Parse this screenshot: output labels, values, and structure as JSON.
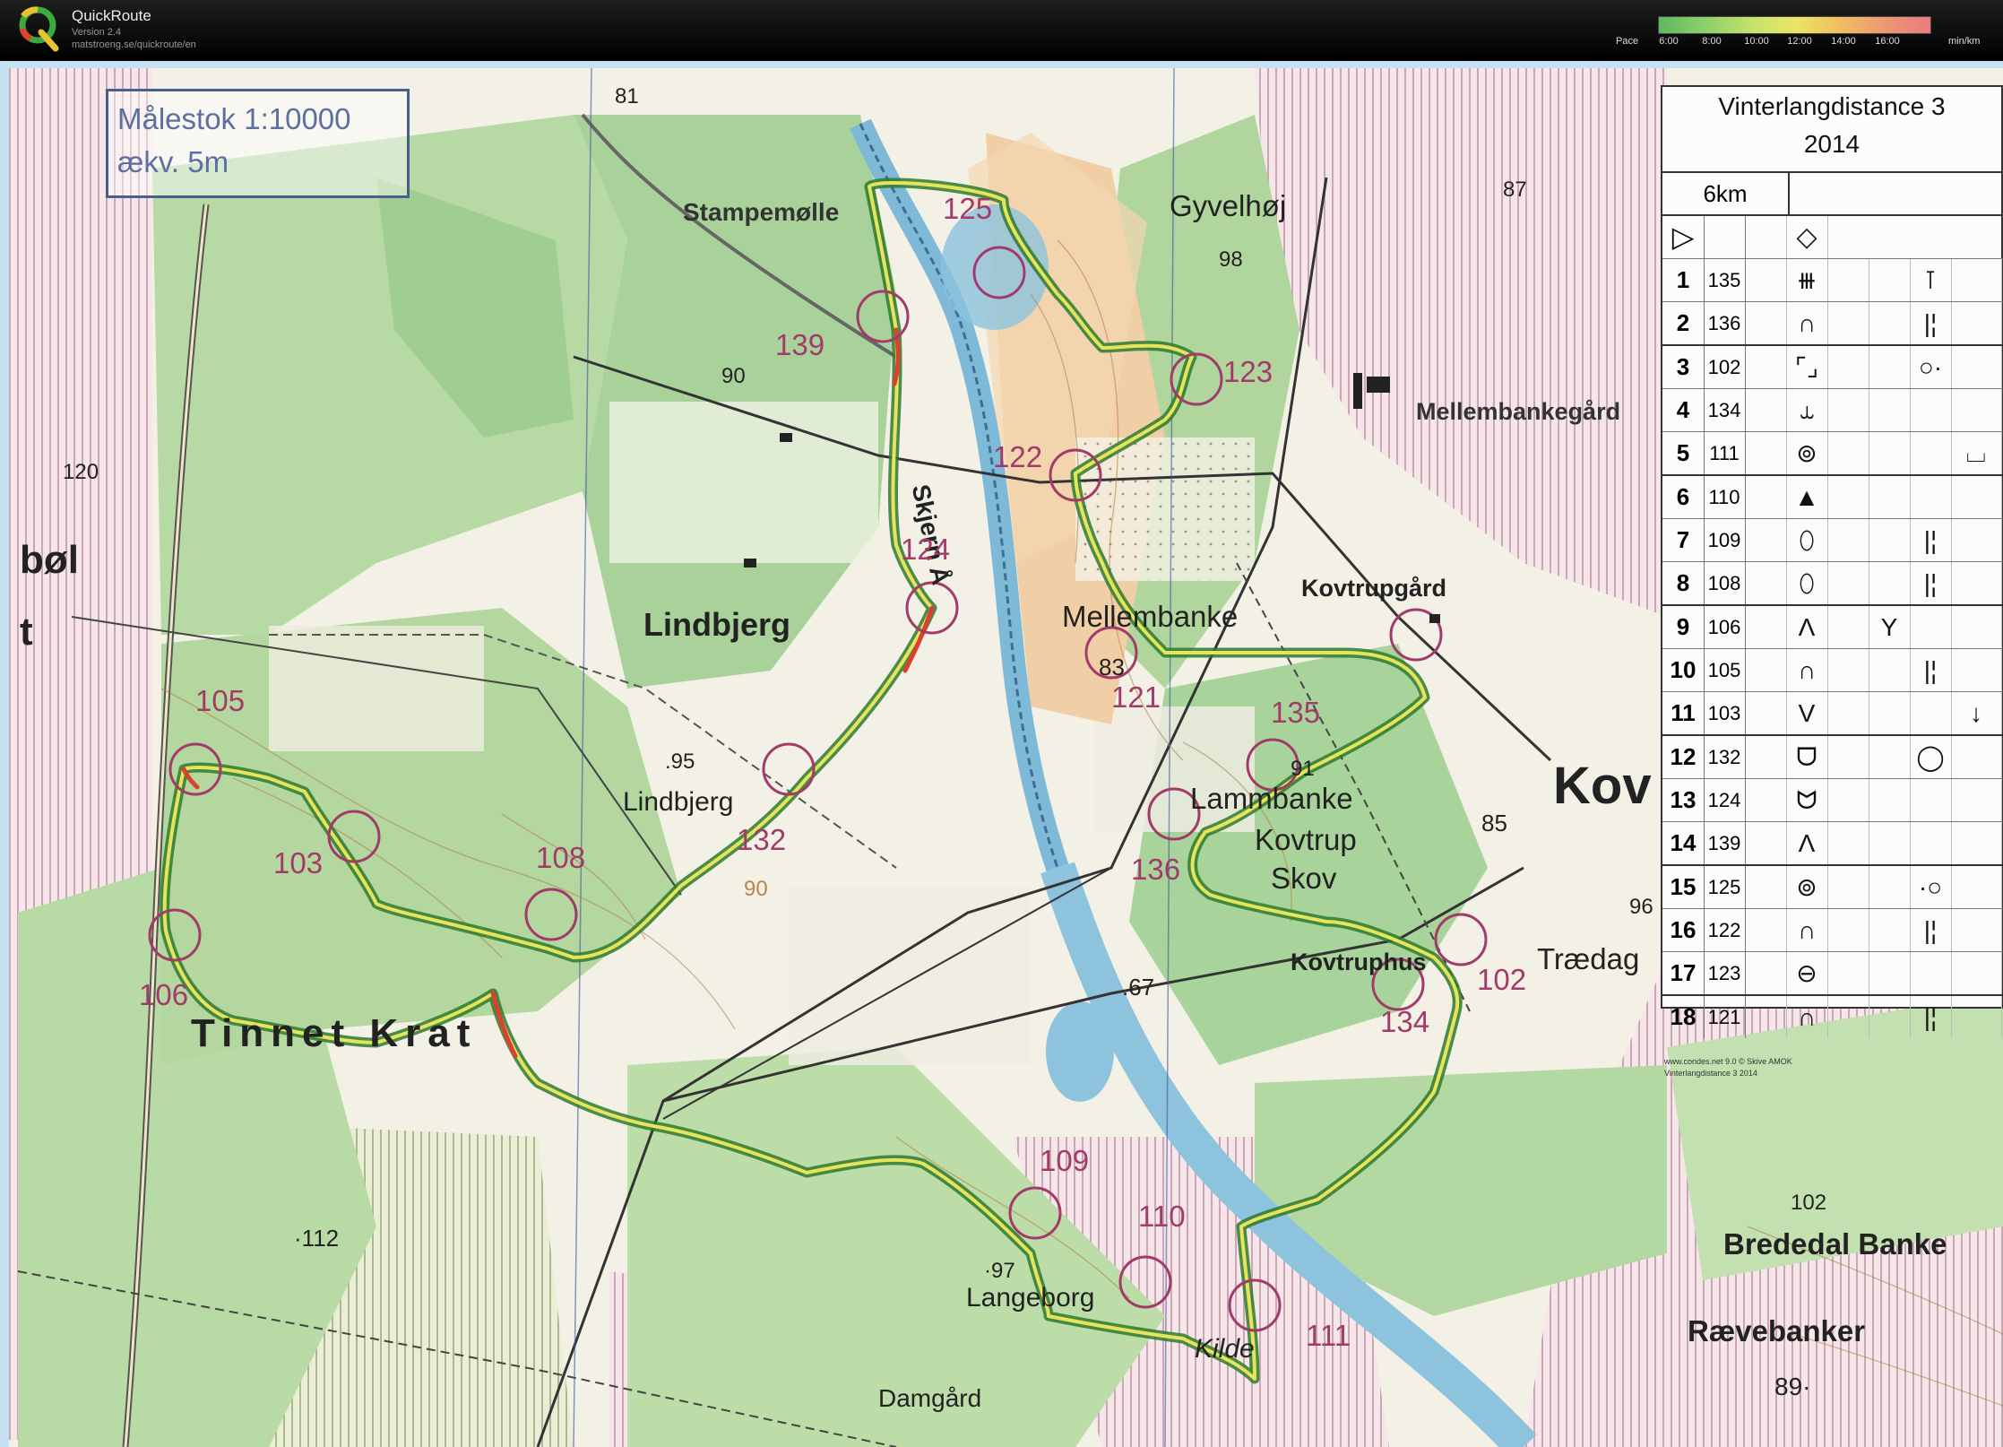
{
  "app": {
    "name": "QuickRoute",
    "version": "Version 2.4",
    "url": "matstroeng.se/quickroute/en"
  },
  "pace": {
    "label": "Pace",
    "ticks": [
      "6:00",
      "8:00",
      "10:00",
      "12:00",
      "14:00",
      "16:00"
    ],
    "unit": "min/km",
    "colors": [
      "#5eb85e",
      "#c9e46a",
      "#e9e565",
      "#f0c060",
      "#e87b80"
    ]
  },
  "map": {
    "scale_line1": "Målestok 1:10000",
    "scale_line2": "ækv. 5m",
    "place_names": {
      "stampemolle": "Stampemølle",
      "gyvelhoj": "Gyvelhøj",
      "mellembankegard": "Mellembankegård",
      "skjern_a": "Skjern Å",
      "lindbjerg_1": "Lindbjerg",
      "lindbjerg_2": "Lindbjerg",
      "mellembanke": "Mellembanke",
      "kovtrupgard": "Kovtrupgård",
      "kov": "Kov",
      "lammbanke": "Lammbanke",
      "kovtrup_skov_1": "Kovtrup",
      "kovtrup_skov_2": "Skov",
      "kovtruphus": "Kovtruphus",
      "traedag": "Trædag",
      "tinnet_krat": "Tinnet Krat",
      "langeborg": "Langeborg",
      "kilde": "Kilde",
      "damgard": "Damgård",
      "bredebal_banke": "Brededal Banke",
      "raevebanker": "Rævebanker",
      "bol": "bøl",
      "t": "t"
    },
    "heights": {
      "h81": "81",
      "h87": "87",
      "h98": "98",
      "h90": "90",
      "h120": "120",
      "h83": "83",
      "h95": ".95",
      "h85": "85",
      "h91": "91",
      "h96": "96",
      "h90b": "90",
      "h67": ".67",
      "h112": "·112",
      "h97": "·97",
      "h102": "102",
      "h89": "89·"
    },
    "controls": [
      {
        "code": "125"
      },
      {
        "code": "139"
      },
      {
        "code": "123"
      },
      {
        "code": "122"
      },
      {
        "code": "124"
      },
      {
        "code": "121"
      },
      {
        "code": "135"
      },
      {
        "code": "105"
      },
      {
        "code": "103"
      },
      {
        "code": "108"
      },
      {
        "code": "132"
      },
      {
        "code": "136"
      },
      {
        "code": "106"
      },
      {
        "code": "102"
      },
      {
        "code": "134"
      },
      {
        "code": "109"
      },
      {
        "code": "110"
      },
      {
        "code": "111"
      }
    ],
    "credit_line1": "www.condes.net 9.0 © Skive AMOK",
    "credit_line2": "Vinterlangdistance 3 2014"
  },
  "control_description": {
    "title": "Vinterlangdistance 3",
    "year": "2014",
    "distance": "6km",
    "start_symbol": "▷",
    "start_feature": "◇",
    "rows": [
      {
        "n": "1",
        "code": "135",
        "feature": "⧻",
        "detail": "",
        "position": "⊺",
        "extra": ""
      },
      {
        "n": "2",
        "code": "136",
        "feature": "∩",
        "detail": "",
        "position": "|¦",
        "extra": ""
      },
      {
        "n": "3",
        "code": "102",
        "feature": "⌜⌟",
        "detail": "",
        "position": "○·",
        "extra": ""
      },
      {
        "n": "4",
        "code": "134",
        "feature": "⥿",
        "detail": "",
        "position": "",
        "extra": ""
      },
      {
        "n": "5",
        "code": "111",
        "feature": "⊚",
        "detail": "",
        "position": "",
        "extra": "⌴"
      },
      {
        "n": "6",
        "code": "110",
        "feature": "▲",
        "detail": "",
        "position": "",
        "extra": ""
      },
      {
        "n": "7",
        "code": "109",
        "feature": "⬯",
        "detail": "",
        "position": "|¦",
        "extra": ""
      },
      {
        "n": "8",
        "code": "108",
        "feature": "⬯",
        "detail": "",
        "position": "|¦",
        "extra": ""
      },
      {
        "n": "9",
        "code": "106",
        "feature": "Λ",
        "detail": "Y",
        "position": "",
        "extra": ""
      },
      {
        "n": "10",
        "code": "105",
        "feature": "∩",
        "detail": "",
        "position": "|¦",
        "extra": ""
      },
      {
        "n": "11",
        "code": "103",
        "feature": "V",
        "detail": "",
        "position": "",
        "extra": "↓"
      },
      {
        "n": "12",
        "code": "132",
        "feature": "ᗜ",
        "detail": "",
        "position": "◯",
        "extra": ""
      },
      {
        "n": "13",
        "code": "124",
        "feature": "ᗢ",
        "detail": "",
        "position": "",
        "extra": ""
      },
      {
        "n": "14",
        "code": "139",
        "feature": "Λ",
        "detail": "",
        "position": "",
        "extra": ""
      },
      {
        "n": "15",
        "code": "125",
        "feature": "⊚",
        "detail": "",
        "position": "·○",
        "extra": ""
      },
      {
        "n": "16",
        "code": "122",
        "feature": "∩",
        "detail": "",
        "position": "|¦",
        "extra": ""
      },
      {
        "n": "17",
        "code": "123",
        "feature": "⊖",
        "detail": "",
        "position": "",
        "extra": ""
      },
      {
        "n": "18",
        "code": "121",
        "feature": "∩",
        "detail": "",
        "position": "|¦",
        "extra": ""
      }
    ]
  }
}
